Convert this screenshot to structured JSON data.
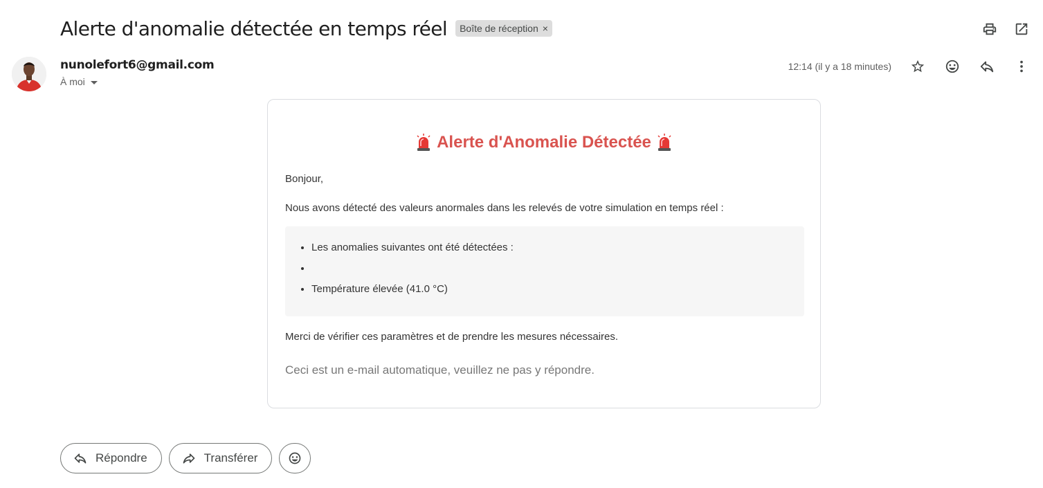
{
  "email": {
    "subject": "Alerte d'anomalie détectée en temps réel",
    "label": "Boîte de réception",
    "label_close": "×",
    "sender_email": "nunolefort6@gmail.com",
    "recipient": "À moi",
    "timestamp": "12:14 (il y a 18 minutes)"
  },
  "icons": {
    "top": [
      "print-icon",
      "open-in-new-window-icon"
    ],
    "meta": [
      "star-icon",
      "emoji-reaction-icon",
      "reply-icon",
      "more-vertical-icon"
    ]
  },
  "body": {
    "title": "Alerte d'Anomalie Détectée",
    "greeting": "Bonjour,",
    "intro": "Nous avons détecté des valeurs anormales dans les relevés de votre simulation en temps réel :",
    "anomalies": [
      "Les anomalies suivantes ont été détectées :",
      "",
      "Température élevée (41.0 °C)"
    ],
    "request": "Merci de vérifier ces paramètres et de prendre les mesures nécessaires.",
    "footer": "Ceci est un e-mail automatique, veuillez ne pas y répondre.",
    "title_color": "#d9534f"
  },
  "actions": {
    "reply": "Répondre",
    "forward": "Transférer"
  }
}
